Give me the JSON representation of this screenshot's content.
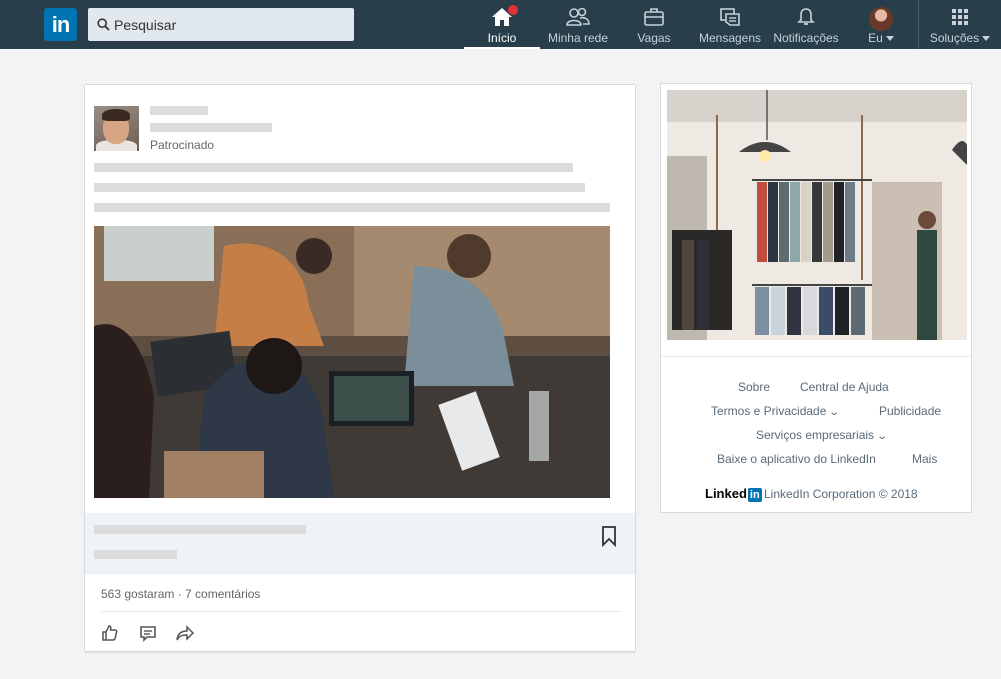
{
  "nav": {
    "logo_text": "in",
    "search_placeholder": "Pesquisar",
    "items": [
      {
        "label": "Início"
      },
      {
        "label": "Minha rede"
      },
      {
        "label": "Vagas"
      },
      {
        "label": "Mensagens"
      },
      {
        "label": "Notificações"
      },
      {
        "label": "Eu"
      },
      {
        "label": "Soluções"
      }
    ],
    "colors": {
      "bar": "#283e4a",
      "brand": "#0073b1",
      "badge": "#e0313a"
    }
  },
  "post": {
    "sponsored_label": "Patrocinado",
    "counts": "563 gostaram · 7 comentários",
    "actions": [
      "like-icon",
      "comment-icon",
      "share-icon"
    ]
  },
  "rail": {
    "footer_links": [
      {
        "label": "Sobre"
      },
      {
        "label": "Central de Ajuda"
      },
      {
        "label": "Termos e Privacidade"
      },
      {
        "label": "Publicidade"
      },
      {
        "label": "Serviços empresariais"
      },
      {
        "label": "Baixe o aplicativo do LinkedIn"
      },
      {
        "label": "Mais"
      }
    ],
    "brand_text": "Linked",
    "brand_in": "in",
    "copyright": "LinkedIn Corporation © 2018"
  }
}
